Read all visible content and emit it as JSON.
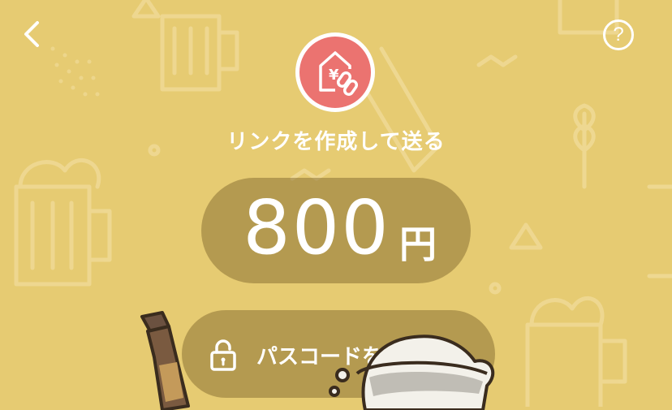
{
  "colors": {
    "background": "#e6cb72",
    "badge": "#eb7370",
    "pill": "#8a6f2e"
  },
  "header": {
    "back_icon": "chevron-left-icon",
    "help_label": "?"
  },
  "badge": {
    "icon": "house-yen-link-icon"
  },
  "title": "リンクを作成して送る",
  "amount": {
    "value": "800",
    "unit": "円"
  },
  "passcode": {
    "icon": "lock-icon",
    "label": "パスコードを設定する"
  }
}
